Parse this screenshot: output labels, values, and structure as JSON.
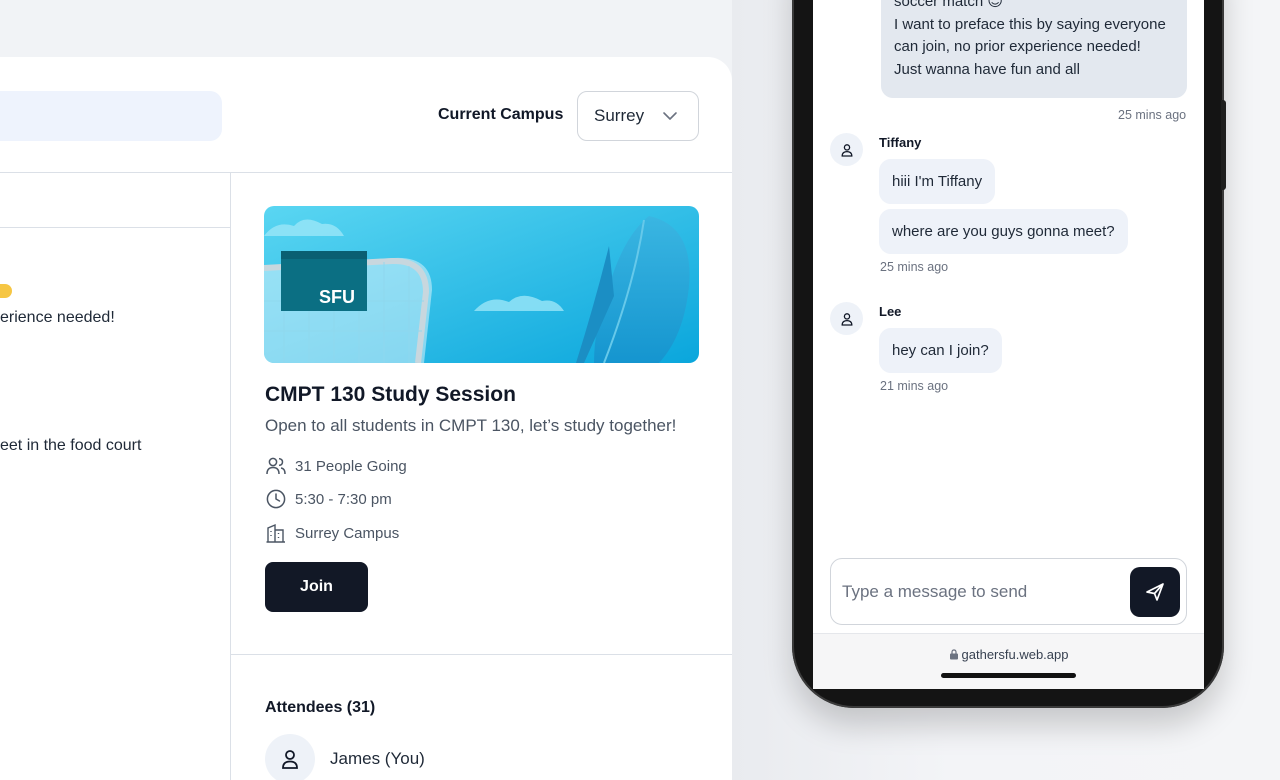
{
  "header": {
    "campus_label": "Current Campus",
    "campus_selected": "Surrey"
  },
  "chat_preview": {
    "line1": "erience needed!",
    "line2": "eet in the food court"
  },
  "event": {
    "banner_text": "SFU",
    "title": "CMPT 130 Study Session",
    "description": "Open to all students in CMPT 130, let’s study together!",
    "people_going": "31 People Going",
    "time": "5:30 - 7:30 pm",
    "location": "Surrey Campus",
    "join_label": "Join"
  },
  "attendees": {
    "title": "Attendees (31)",
    "items": [
      {
        "name": "James (You)"
      }
    ]
  },
  "phone_chat": {
    "my_message": {
      "lines": [
        "soccer match 😊",
        "I want to preface this by saying everyone",
        "can join, no prior experience needed!",
        "Just wanna have fun and all"
      ],
      "time": "25 mins ago"
    },
    "messages": [
      {
        "sender": "Tiffany",
        "bubbles": [
          "hiii I'm Tiffany",
          "where are you guys gonna meet?"
        ],
        "time": "25 mins ago"
      },
      {
        "sender": "Lee",
        "bubbles": [
          "hey can I join?"
        ],
        "time": "21 mins ago"
      }
    ],
    "input_placeholder": "Type a message to send",
    "url": "gathersfu.web.app"
  },
  "colors": {
    "primary_button": "#121826",
    "bubble": "#eef2f9",
    "banner_sky": "#4fd0f0"
  }
}
